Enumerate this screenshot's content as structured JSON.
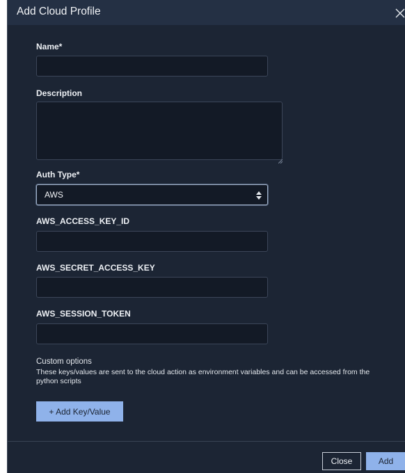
{
  "dialog": {
    "title": "Add Cloud Profile",
    "close_icon": "close-icon"
  },
  "form": {
    "name_label": "Name*",
    "name_value": "",
    "description_label": "Description",
    "description_value": "",
    "auth_type_label": "Auth Type*",
    "auth_type_value": "AWS",
    "access_key_label": "AWS_ACCESS_KEY_ID",
    "access_key_value": "",
    "secret_key_label": "AWS_SECRET_ACCESS_KEY",
    "secret_key_value": "",
    "session_token_label": "AWS_SESSION_TOKEN",
    "session_token_value": ""
  },
  "custom": {
    "title": "Custom options",
    "description": "These keys/values are sent to the cloud action as environment variables and can be accessed from the python scripts",
    "add_button": "+ Add Key/Value"
  },
  "footer": {
    "close_label": "Close",
    "add_label": "Add"
  },
  "colors": {
    "background": "#1c2534",
    "titlebar": "#243044",
    "input_bg": "#131a26",
    "accent": "#8fb2ea"
  }
}
